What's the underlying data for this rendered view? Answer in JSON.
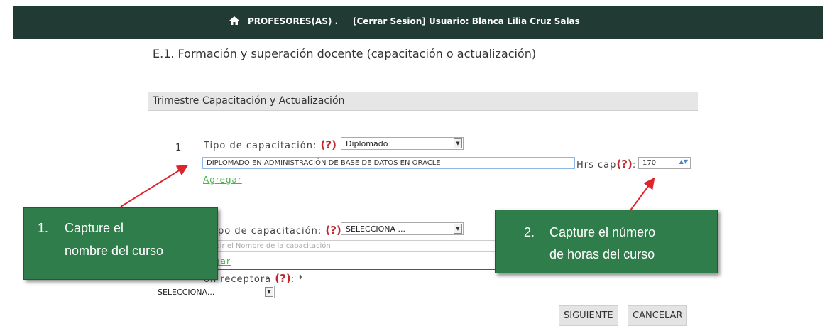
{
  "nav": {
    "section": "PROFESORES(AS) .",
    "session": "[Cerrar Sesion] Usuario: Blanca Lilia Cruz Salas"
  },
  "page_title": "E.1. Formación y superación docente (capacitación o actualización)",
  "table": {
    "col_trimestre": "Trimestre",
    "col_capacitacion": "Capacitación y Actualización"
  },
  "row1": {
    "number": "1",
    "tipo_label": "Tipo de capacitación:",
    "help": "(?)",
    "tipo_value": "Diplomado",
    "nombre_value": "DIPLOMADO EN ADMINISTRACIÓN DE BASE DE DATOS EN ORACLE",
    "hrs_label": "Hrs cap",
    "hrs_sep": ":",
    "hrs_value": "170",
    "agregar": "Agregar"
  },
  "row2": {
    "tipo_label_visible": "po de capacitación:",
    "help": "(?)",
    "tipo_value": "SELECCIONA ...",
    "nombre_placeholder": "cribir el Nombre de la capacitación",
    "agregar_visible": "regar"
  },
  "institucion": {
    "label_visible": "ón receptora",
    "help": "(?)",
    "required": ": *",
    "select_value": "SELECCIONA..."
  },
  "buttons": {
    "siguiente": "SIGUIENTE",
    "cancelar": "CANCELAR"
  },
  "callouts": {
    "one_number": "1.",
    "one_line1": "Capture el",
    "one_line2": "nombre del curso",
    "two_number": "2.",
    "two_line1": "Capture el número",
    "two_line2": "de horas del curso"
  },
  "colors": {
    "topbar": "#213a33",
    "callout": "#2e7d4a",
    "help": "#c0282d",
    "arrow": "#e0242b"
  }
}
